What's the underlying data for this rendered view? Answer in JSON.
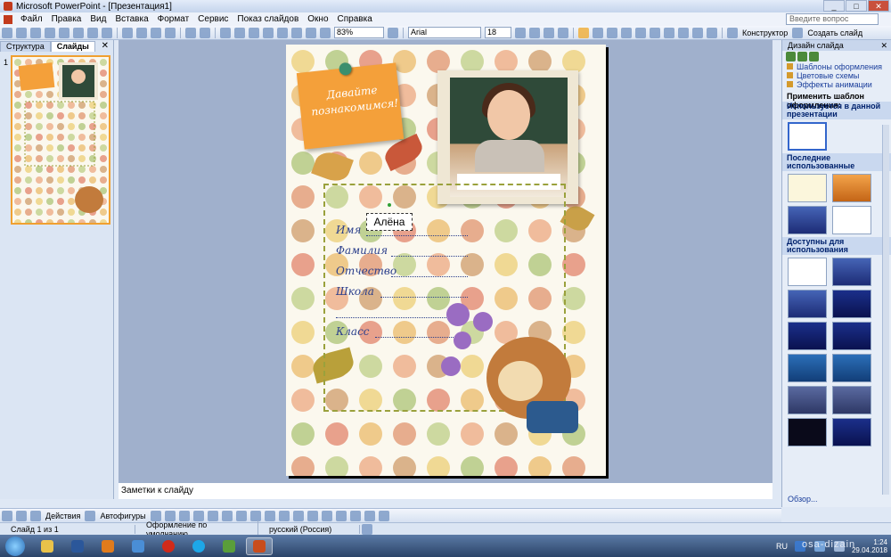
{
  "window": {
    "title": "Microsoft PowerPoint - [Презентация1]",
    "min": "_",
    "max": "□",
    "close": "✕"
  },
  "menu": {
    "items": [
      "Файл",
      "Правка",
      "Вид",
      "Вставка",
      "Формат",
      "Сервис",
      "Показ слайдов",
      "Окно",
      "Справка"
    ],
    "help_placeholder": "Введите вопрос"
  },
  "toolbar": {
    "zoom": "83%",
    "font": "Arial",
    "font_size": "18",
    "designer_label": "Конструктор",
    "new_slide_label": "Создать слайд"
  },
  "left_panel": {
    "tab_structure": "Структура",
    "tab_slides": "Слайды",
    "close": "✕",
    "slide_number": "1",
    "thumb_title": "Давайте познакомимся!"
  },
  "slide": {
    "sticky_text": "Давайте познакомимся!",
    "name_value": "Алёна",
    "fields": [
      {
        "label": "Имя"
      },
      {
        "label": "Фамилия"
      },
      {
        "label": "Отчество"
      },
      {
        "label": "Школа"
      },
      {
        "label": ""
      },
      {
        "label": "Класс"
      }
    ]
  },
  "notes": {
    "placeholder": "Заметки к слайду"
  },
  "right_panel": {
    "title": "Дизайн слайда",
    "close": "✕",
    "links": [
      "Шаблоны оформления",
      "Цветовые схемы",
      "Эффекты анимации"
    ],
    "apply_label": "Применить шаблон оформления:",
    "sections": [
      "Используется в данной презентации",
      "Последние использованные",
      "Доступны для использования"
    ],
    "browse": "Обзор..."
  },
  "drawbar": {
    "actions": "Действия",
    "autoshapes": "Автофигуры"
  },
  "status": {
    "slide": "Слайд 1 из 1",
    "design": "Оформление по умолчанию",
    "language": "русский (Россия)"
  },
  "taskbar": {
    "lang": "RU",
    "time": "1:24",
    "date": "29.04.2018",
    "watermark": "osa-dizain"
  }
}
